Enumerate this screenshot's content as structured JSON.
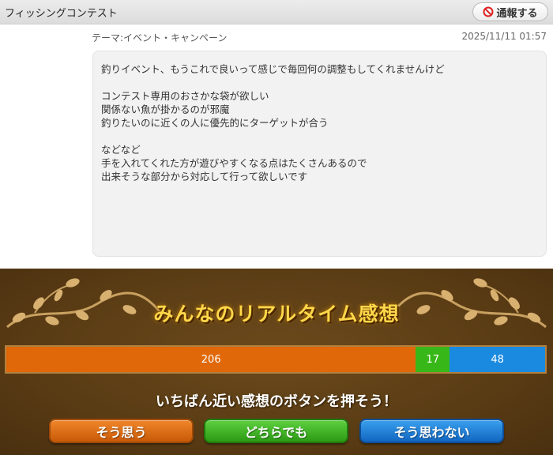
{
  "header": {
    "title": "フィッシングコンテスト",
    "report_label": "通報する"
  },
  "post": {
    "theme": "テーマ:イベント・キャンペーン",
    "timestamp": "2025/11/11 01:57",
    "lines": [
      "釣りイベント、もうこれで良いって感じで毎回何の調整もしてくれませんけど",
      "",
      "コンテスト専用のおさかな袋が欲しい",
      "関係ない魚が掛かるのが邪魔",
      "釣りたいのに近くの人に優先的にターゲットが合う",
      "",
      "などなど",
      "手を入れてくれた方が遊びやすくなる点はたくさんあるので",
      "出来そうな部分から対応して行って欲しいです"
    ]
  },
  "reaction": {
    "title": "みんなのリアルタイム感想",
    "counts": {
      "agree": "206",
      "either": "17",
      "disagree": "48"
    },
    "prompt": "いちばん近い感想のボタンを押そう！",
    "buttons": {
      "agree": "そう思う",
      "either": "どちらでも",
      "disagree": "そう思わない"
    },
    "colors": {
      "agree": "#e06808",
      "either": "#38b818",
      "disagree": "#1a8ae0"
    }
  }
}
